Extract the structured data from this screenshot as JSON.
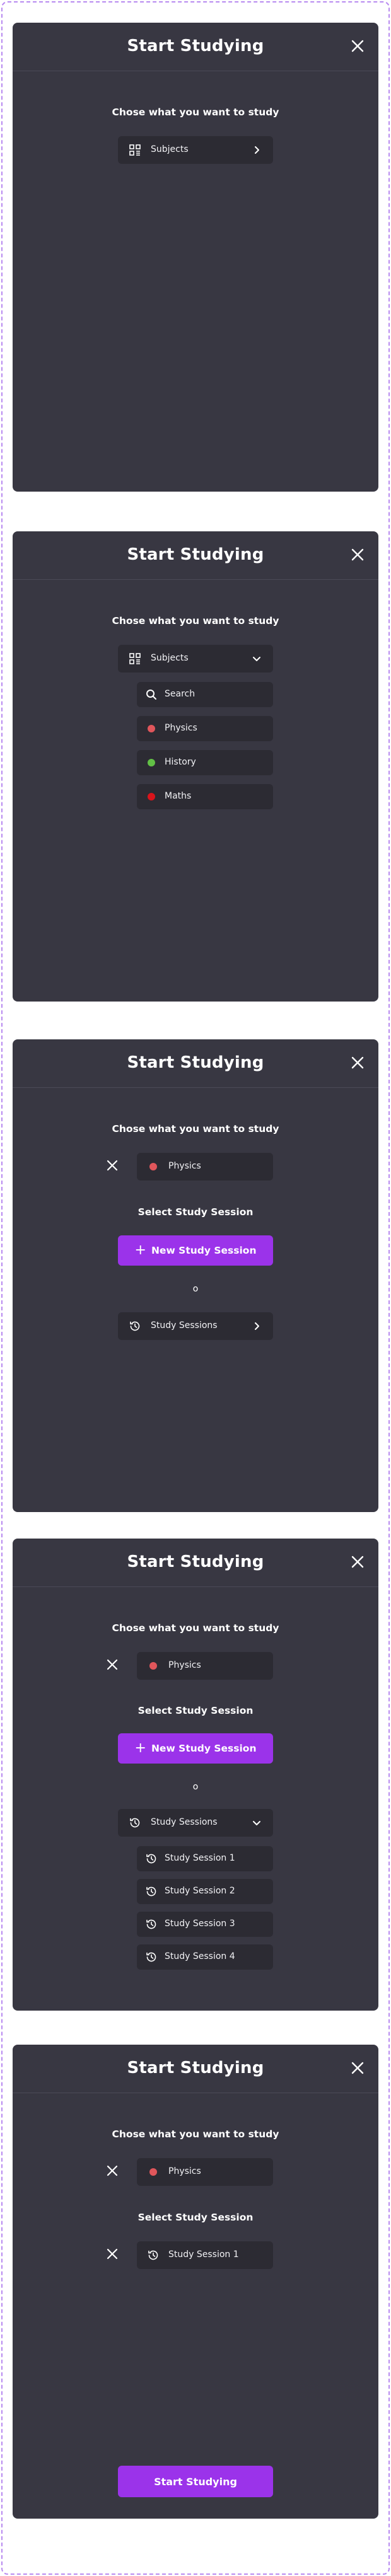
{
  "modal": {
    "title": "Start Studying",
    "choose_prompt": "Chose what you want to study",
    "select_session_prompt": "Select Study Session"
  },
  "subjects": {
    "label": "Subjects",
    "search_label": "Search",
    "items": [
      {
        "label": "Physics",
        "color": "#e0565b"
      },
      {
        "label": "History",
        "color": "#62c046"
      },
      {
        "label": "Maths",
        "color": "#d9141b"
      }
    ]
  },
  "selected_subject": {
    "label": "Physics",
    "color": "#e0565b"
  },
  "sessions": {
    "new_button_label": "New Study Session",
    "plus_symbol": "+",
    "or_label": "o",
    "label": "Study Sessions",
    "items": [
      "Study Session 1",
      "Study Session 2",
      "Study Session 3",
      "Study Session 4"
    ]
  },
  "selected_session": {
    "label": "Study Session 1"
  },
  "start_button_label": "Start Studying",
  "colors": {
    "panel": "#383742",
    "field": "#2c2b33",
    "accent": "#9b33ea"
  }
}
